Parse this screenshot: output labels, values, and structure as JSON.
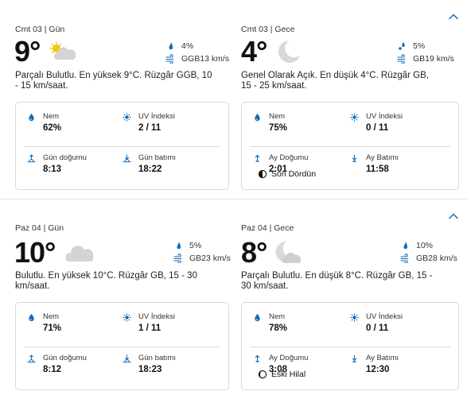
{
  "days": [
    {
      "day": {
        "header": "Cmt 03 | Gün",
        "temp": "9°",
        "icon": "partly-cloudy-day-icon",
        "precip": "4%",
        "wind": "GGB13 km/s",
        "desc": "Parçalı Bulutlu. En yüksek 9°C. Rüzgâr GGB, 10 - 15 km/saat.",
        "humidity_label": "Nem",
        "humidity": "62%",
        "uv_label": "UV İndeksi",
        "uv": "2 / 11",
        "rise_label": "Gün doğumu",
        "rise": "8:13",
        "set_label": "Gün batımı",
        "set": "18:22"
      },
      "night": {
        "header": "Cmt 03 | Gece",
        "temp": "4°",
        "icon": "clear-night-moon-icon",
        "precip": "5%",
        "wind": "GB19 km/s",
        "desc": "Genel Olarak Açık. En düşük 4°C. Rüzgâr GB, 15 - 25 km/saat.",
        "humidity_label": "Nem",
        "humidity": "75%",
        "uv_label": "UV İndeksi",
        "uv": "0 / 11",
        "rise_label": "Ay Doğumu",
        "rise": "2:01",
        "set_label": "Ay Batımı",
        "set": "11:58",
        "moon_phase": "Son Dördün"
      }
    },
    {
      "day": {
        "header": "Paz 04 | Gün",
        "temp": "10°",
        "icon": "cloudy-icon",
        "precip": "5%",
        "wind": "GB23 km/s",
        "desc": "Bulutlu. En yüksek 10°C. Rüzgâr GB, 15 - 30 km/saat.",
        "humidity_label": "Nem",
        "humidity": "71%",
        "uv_label": "UV İndeksi",
        "uv": "1 / 11",
        "rise_label": "Gün doğumu",
        "rise": "8:12",
        "set_label": "Gün batımı",
        "set": "18:23"
      },
      "night": {
        "header": "Paz 04 | Gece",
        "temp": "8°",
        "icon": "partly-cloudy-night-icon",
        "precip": "10%",
        "wind": "GB28 km/s",
        "desc": "Parçalı Bulutlu. En düşük 8°C. Rüzgâr GB, 15 - 30 km/saat.",
        "humidity_label": "Nem",
        "humidity": "78%",
        "uv_label": "UV İndeksi",
        "uv": "0 / 11",
        "rise_label": "Ay Doğumu",
        "rise": "3:08",
        "set_label": "Ay Batımı",
        "set": "12:30",
        "moon_phase": "Eski Hilal"
      }
    }
  ],
  "colors": {
    "accent": "#0f6cbd",
    "text": "#1b1b1b",
    "border": "#d9d9d9",
    "sun": "#f5c518"
  }
}
